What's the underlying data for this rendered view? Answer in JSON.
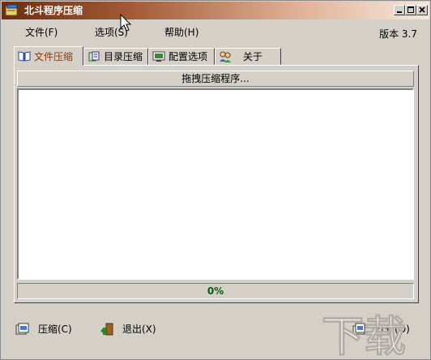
{
  "window": {
    "title": "北斗程序压缩"
  },
  "titlebar_buttons": [
    "0",
    "1",
    "r"
  ],
  "menu": {
    "file": "文件(F)",
    "options": "选项(S)",
    "help": "帮助(H)",
    "version": "版本 3.7"
  },
  "tabs": [
    {
      "label": "文件压缩",
      "icon": "book-icon",
      "active": true
    },
    {
      "label": "目录压缩",
      "icon": "files-icon",
      "active": false
    },
    {
      "label": "配置选项",
      "icon": "config-icon",
      "active": false
    },
    {
      "label": "关于",
      "icon": "people-icon",
      "active": false
    }
  ],
  "panel": {
    "drop_hint": "拖拽压缩程序..."
  },
  "progress": {
    "value_text": "0%",
    "value": 0
  },
  "actions": {
    "compress": "压缩(C)",
    "exit": "退出(X)",
    "open": "打开(O)"
  },
  "watermark": {
    "text": "下载"
  },
  "colors": {
    "title_start": "#6b2f11",
    "title_end": "#f6e7dc",
    "face": "#d4d0c8",
    "active_tab_text": "#8a3a10",
    "progress_text": "#0a5a0a"
  }
}
